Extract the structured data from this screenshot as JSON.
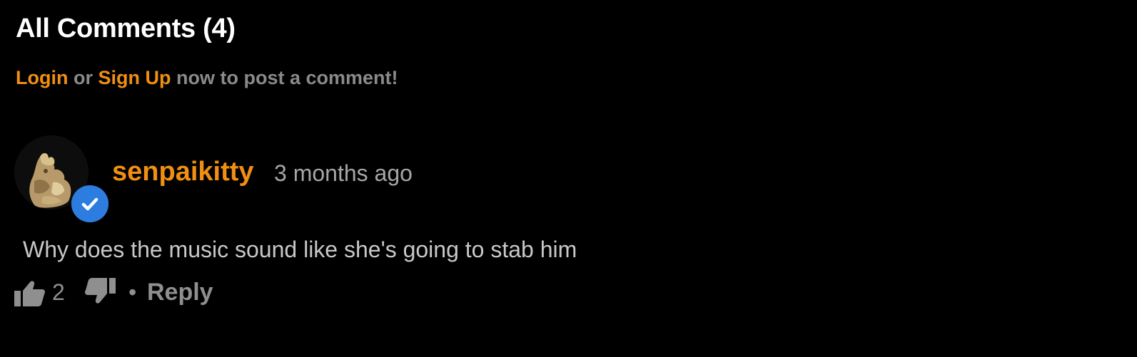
{
  "comments_section": {
    "title": "All Comments (4)",
    "prompt": {
      "login_label": "Login",
      "or_text": " or ",
      "signup_label": "Sign Up",
      "suffix_text": " now to post a comment!"
    }
  },
  "comment": {
    "username": "senpaikitty",
    "timestamp": "3 months ago",
    "verified_icon": "check-icon",
    "text": "Why does the music sound like she's going to stab him",
    "like_icon": "thumbs-up-icon",
    "like_count": "2",
    "dislike_icon": "thumbs-down-icon",
    "separator": "•",
    "reply_label": "Reply"
  },
  "colors": {
    "background": "#000000",
    "accent": "#f08f11",
    "verified_badge": "#2d7de0",
    "muted_text": "#8f8f8f",
    "body_text": "#c8c8c8"
  }
}
